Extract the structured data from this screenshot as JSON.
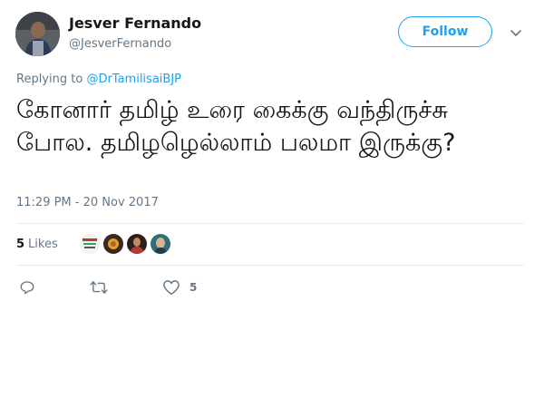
{
  "author": {
    "display_name": "Jesver Fernando",
    "handle": "@JesverFernando"
  },
  "follow_label": "Follow",
  "reply_context": {
    "prefix": "Replying to",
    "mention": "@DrTamilisaiBJP"
  },
  "tweet": {
    "text": "கோனார் தமிழ் உரை கைக்கு வந்திருச்சு போல. தமிழழெல்லாம் பலமா இருக்கு?",
    "timestamp": "11:29 PM - 20 Nov 2017"
  },
  "likes": {
    "count": "5",
    "label": "Likes"
  },
  "actions": {
    "like_count": "5"
  },
  "colors": {
    "accent": "#1da1f2",
    "secondary_text": "#657786",
    "primary_text": "#14171a",
    "divider": "#e6ecf0"
  },
  "icons": [
    "chevron-down-icon",
    "reply-icon",
    "retweet-icon",
    "heart-icon"
  ]
}
